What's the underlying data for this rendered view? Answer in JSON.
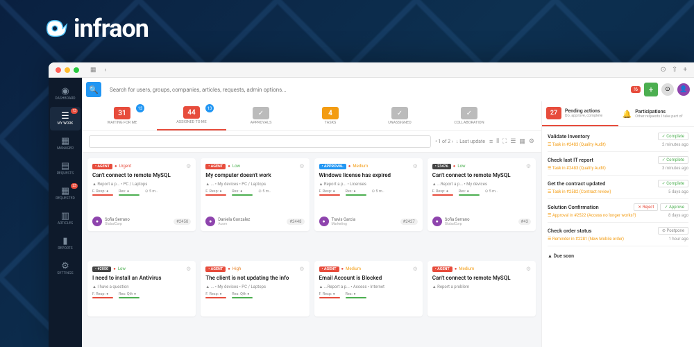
{
  "brand": "infraon",
  "search": {
    "placeholder": "Search for users, groups, companies, articles, requests, admin options..."
  },
  "header": {
    "notif": "6",
    "notif_small": "0"
  },
  "sidebar": [
    {
      "icon": "◉",
      "label": "DASHBOARD",
      "badge": null
    },
    {
      "icon": "☰",
      "label": "MY WORK",
      "badge": "13",
      "active": true
    },
    {
      "icon": "▦",
      "label": "MANAGER",
      "badge": null
    },
    {
      "icon": "▤",
      "label": "REQUESTS",
      "badge": null
    },
    {
      "icon": "▦",
      "label": "REQUESTED",
      "badge": "23"
    },
    {
      "icon": "▥",
      "label": "ARTICLES",
      "badge": null
    },
    {
      "icon": "▮",
      "label": "REPORTS",
      "badge": null
    },
    {
      "icon": "⚙",
      "label": "SETTINGS",
      "badge": null
    }
  ],
  "tabs": [
    {
      "num": "31",
      "label": "WAITING FOR ME",
      "badge": "13",
      "cls": ""
    },
    {
      "num": "44",
      "label": "ASSIGNED TO ME",
      "badge": "13",
      "cls": "",
      "active": true
    },
    {
      "label": "APPROVALS",
      "check": true
    },
    {
      "num": "4",
      "label": "TASKS",
      "cls": "orange"
    },
    {
      "label": "UNASSIGNED",
      "check": true
    },
    {
      "label": "COLLABORATION",
      "check": true
    }
  ],
  "toolbar": {
    "pager": "1 of 2",
    "sort": "Last update"
  },
  "cards": [
    {
      "tag": "AGENT",
      "tagCls": "",
      "prio": "Urgent",
      "prioCls": "urgent",
      "title": "Can't connect to remote MySQL",
      "meta": "Report a p... • PC / Laptops",
      "f": "F. Resp:",
      "r": "Res:",
      "time": "5 m..",
      "user": "Sofia Serrano",
      "org": "GlobalCorp",
      "id": "#2450"
    },
    {
      "tag": "AGENT",
      "tagCls": "",
      "prio": "Low",
      "prioCls": "low",
      "title": "My computer doesn't work",
      "meta": "... • My devices • PC / Laptops",
      "f": "F. Resp:",
      "r": "Res:",
      "time": "5 m..",
      "user": "Daniela Gonzalez",
      "org": "Acorn",
      "id": "#2448"
    },
    {
      "tag": "APPROVAL",
      "tagCls": "blue",
      "prio": "Medium",
      "prioCls": "med",
      "title": "Windows license has expired",
      "meta": "Report a p... • Licenses",
      "f": "F. Resp:",
      "r": "Res:",
      "time": "5 m..",
      "user": "Travis Garcia",
      "org": "Marketing",
      "id": "#2427"
    },
    {
      "tag": "23476",
      "tagCls": "dark",
      "prio": "Low",
      "prioCls": "low",
      "title": "Can't connect to remote MySQL",
      "meta": "...Report a p... • My devices",
      "f": "F. Resp:",
      "r": "Res:",
      "time": "5 m..",
      "user": "Sofia Serrano",
      "org": "GlobalCorp",
      "id": "#43"
    },
    {
      "tag": "#2050",
      "tagCls": "dark",
      "prio": "Low",
      "prioCls": "low",
      "title": "I need to install an Antivirus",
      "meta": "I have a question",
      "f": "F. Resp:",
      "r": "Res: Qth",
      "user": "",
      "id": "",
      "short": true
    },
    {
      "tag": "AGENT",
      "tagCls": "",
      "prio": "High",
      "prioCls": "high",
      "title": "The client is not updating the info",
      "meta": "... • My devices • PC / Laptops",
      "f": "F. Resp:",
      "r": "Res: Qth",
      "user": "",
      "id": "",
      "short": true
    },
    {
      "tag": "AGENT",
      "tagCls": "",
      "prio": "Medium",
      "prioCls": "med",
      "title": "Email Account is Blocked",
      "meta": "...Report a p... • Access • Internet",
      "f": "F. Resp:",
      "r": "Res:",
      "user": "",
      "id": "",
      "short": true
    },
    {
      "tag": "AGENT",
      "tagCls": "",
      "prio": "Medium",
      "prioCls": "med",
      "title": "Can't connect to remote MySQL",
      "meta": "Report a problem",
      "f": "",
      "r": "",
      "user": "",
      "id": "",
      "short": true
    }
  ],
  "panel": {
    "pending": {
      "num": "27",
      "title": "Pending actions",
      "sub": "Do, approve, complete"
    },
    "part": {
      "title": "Participations",
      "sub": "Other requests I take part of"
    },
    "actions": [
      {
        "title": "Validate Inventory",
        "btns": [
          {
            "t": "Complete",
            "cls": ""
          }
        ],
        "meta": "Task in #2483 (Quality Audit)",
        "time": "2 minutes ago"
      },
      {
        "title": "Check last IT report",
        "btns": [
          {
            "t": "Complete",
            "cls": ""
          }
        ],
        "meta": "Task in #2483 (Quality Audit)",
        "time": "3 minutes ago"
      },
      {
        "title": "Get the contract updated",
        "btns": [
          {
            "t": "Complete",
            "cls": ""
          }
        ],
        "meta": "Task in #2582 (Contract review)",
        "time": "5 days ago"
      },
      {
        "title": "Solution Confirmation",
        "btns": [
          {
            "t": "Reject",
            "cls": "reject"
          },
          {
            "t": "Approve",
            "cls": ""
          }
        ],
        "meta": "Approval in #2522 (Access no longer works?)",
        "time": "8 days ago"
      },
      {
        "title": "Check order status",
        "btns": [
          {
            "t": "Postpone",
            "cls": "post"
          }
        ],
        "meta": "Reminder in #2281 (New Mobile order)",
        "time": "1 hour ago"
      }
    ],
    "due": "Due soon"
  }
}
